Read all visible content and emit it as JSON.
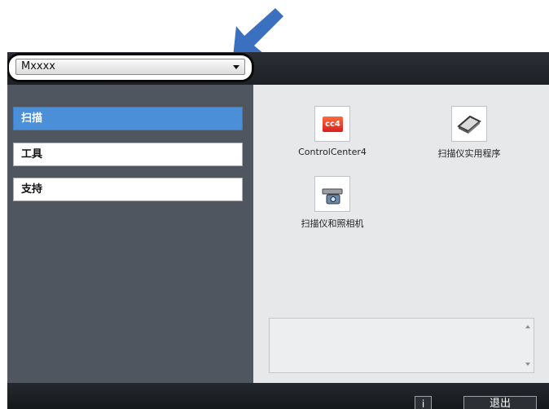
{
  "header": {
    "model_select": {
      "selected": "Mxxxx"
    }
  },
  "sidebar": {
    "items": [
      {
        "label": "扫描",
        "active": true
      },
      {
        "label": "工具",
        "active": false
      },
      {
        "label": "支持",
        "active": false
      }
    ]
  },
  "main": {
    "tiles": [
      {
        "label": "ControlCenter4",
        "icon": "controlcenter4-icon",
        "icon_text": "cc4"
      },
      {
        "label": "扫描仪实用程序",
        "icon": "scanner-icon"
      },
      {
        "label": "扫描仪和照相机",
        "icon": "camera-scanner-icon"
      }
    ]
  },
  "footer": {
    "info_label": "i",
    "exit_label": "退出"
  },
  "colors": {
    "active_nav": "#4b8fd8",
    "sidebar_bg": "#50565f",
    "content_bg": "#e6e8ea",
    "frame_bg": "#1f2226",
    "callout_arrow": "#3b6fc0"
  }
}
